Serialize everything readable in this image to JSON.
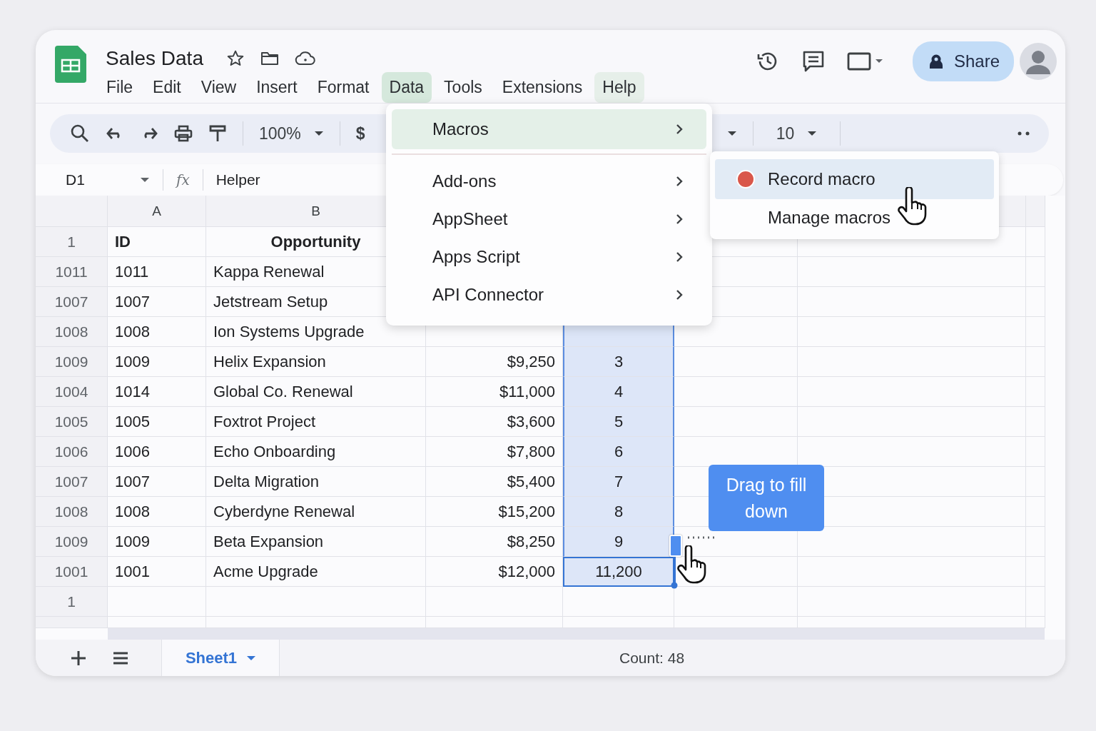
{
  "document": {
    "title": "Sales Data"
  },
  "menu_bar": [
    {
      "label": "File",
      "selected": false,
      "highlighted": false
    },
    {
      "label": "Edit",
      "selected": false,
      "highlighted": false
    },
    {
      "label": "View",
      "selected": false,
      "highlighted": false
    },
    {
      "label": "Insert",
      "selected": false,
      "highlighted": false
    },
    {
      "label": "Format",
      "selected": false,
      "highlighted": false
    },
    {
      "label": "Data",
      "selected": true,
      "highlighted": false
    },
    {
      "label": "Tools",
      "selected": false,
      "highlighted": false
    },
    {
      "label": "Extensions",
      "selected": false,
      "highlighted": false
    },
    {
      "label": "Help",
      "selected": false,
      "highlighted": true
    }
  ],
  "share_button": {
    "label": "Share"
  },
  "toolbar": {
    "zoom": "100%",
    "currency": "$",
    "font_size": "10"
  },
  "formula_bar": {
    "cell_ref": "D1",
    "formula_label": "fx",
    "value": "Helper"
  },
  "grid": {
    "columns": [
      "A",
      "B"
    ],
    "rows": [
      {
        "row_label": "1",
        "kind": "header",
        "id": "ID",
        "opportunity": "Opportunity"
      },
      {
        "row_label": "1011",
        "kind": "data",
        "id": "1011",
        "opportunity": "Kappa Renewal"
      },
      {
        "row_label": "1007",
        "kind": "data",
        "id": "1007",
        "opportunity": "Jetstream Setup"
      },
      {
        "row_label": "1008",
        "kind": "data",
        "id": "1008",
        "opportunity": "Ion Systems Upgrade",
        "in_selection": true,
        "active": false
      },
      {
        "row_label": "1009",
        "kind": "data",
        "id": "1009",
        "opportunity": "Helix Expansion",
        "amount": "$9,250",
        "helper": "3",
        "in_selection": true,
        "active": false
      },
      {
        "row_label": "1004",
        "kind": "data",
        "id": "1014",
        "opportunity": "Global Co. Renewal",
        "amount": "$11,000",
        "helper": "4",
        "in_selection": true,
        "active": false
      },
      {
        "row_label": "1005",
        "kind": "data",
        "id": "1005",
        "opportunity": "Foxtrot Project",
        "amount": "$3,600",
        "helper": "5",
        "in_selection": true,
        "active": false
      },
      {
        "row_label": "1006",
        "kind": "data",
        "id": "1006",
        "opportunity": "Echo Onboarding",
        "amount": "$7,800",
        "helper": "6",
        "in_selection": true,
        "active": false
      },
      {
        "row_label": "1007",
        "kind": "data",
        "id": "1007",
        "opportunity": "Delta Migration",
        "amount": "$5,400",
        "helper": "7",
        "in_selection": true,
        "active": false
      },
      {
        "row_label": "1008",
        "kind": "data",
        "id": "1008",
        "opportunity": "Cyberdyne Renewal",
        "amount": "$15,200",
        "helper": "8",
        "in_selection": true,
        "active": false
      },
      {
        "row_label": "1009",
        "kind": "data",
        "id": "1009",
        "opportunity": "Beta Expansion",
        "amount": "$8,250",
        "helper": "9",
        "in_selection": true,
        "active": false
      },
      {
        "row_label": "1001",
        "kind": "data",
        "id": "1001",
        "opportunity": "Acme Upgrade",
        "amount": "$12,000",
        "helper": "11,200",
        "in_selection": true,
        "active": true
      },
      {
        "row_label": "1",
        "kind": "empty"
      }
    ]
  },
  "data_menu": {
    "items": [
      {
        "label": "Macros",
        "selected": true
      },
      {
        "label": "Add-ons",
        "selected": false
      },
      {
        "label": "AppSheet",
        "selected": false
      },
      {
        "label": "Apps Script",
        "selected": false
      },
      {
        "label": "API Connector",
        "selected": false
      }
    ]
  },
  "macros_submenu": {
    "items": [
      {
        "label": "Record macro",
        "kind": "record",
        "selected": true
      },
      {
        "label": "Manage macros",
        "kind": "plain",
        "selected": false
      }
    ]
  },
  "tooltip": {
    "text": "Drag to fill down"
  },
  "sheet_tabs": [
    {
      "label": "Sheet1",
      "selected": true
    }
  ],
  "status_bar": {
    "summary": "Count: 48"
  }
}
